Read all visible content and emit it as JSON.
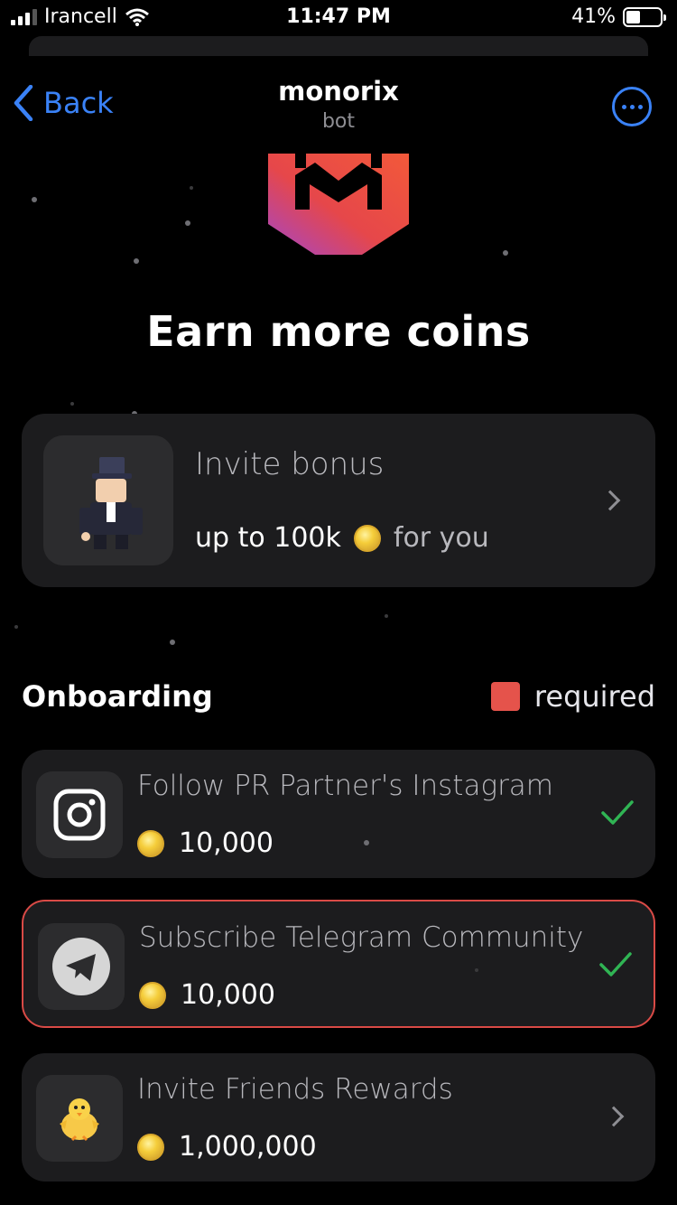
{
  "status": {
    "carrier": "Irancell",
    "time": "11:47 PM",
    "battery": "41%",
    "battery_level": 0.41
  },
  "nav": {
    "back_label": "Back",
    "title": "monorix",
    "subtitle": "bot"
  },
  "headline": "Earn more coins",
  "invite": {
    "title": "Invite bonus",
    "amount": "up to 100k",
    "suffix": "for you"
  },
  "section": {
    "title": "Onboarding",
    "legend": "required"
  },
  "tasks": [
    {
      "title": "Follow PR Partner's Instagram",
      "reward": "10,000",
      "icon": "instagram-icon",
      "status": "completed"
    },
    {
      "title": "Subscribe Telegram Community",
      "reward": "10,000",
      "icon": "telegram-icon",
      "status": "completed",
      "required": true
    },
    {
      "title": "Invite Friends Rewards",
      "reward": "1,000,000",
      "icon": "chick-icon",
      "status": "open"
    }
  ],
  "colors": {
    "accent": "#3a82f7",
    "required": "#e5534b",
    "check": "#30b454",
    "card": "#1c1c1e"
  }
}
